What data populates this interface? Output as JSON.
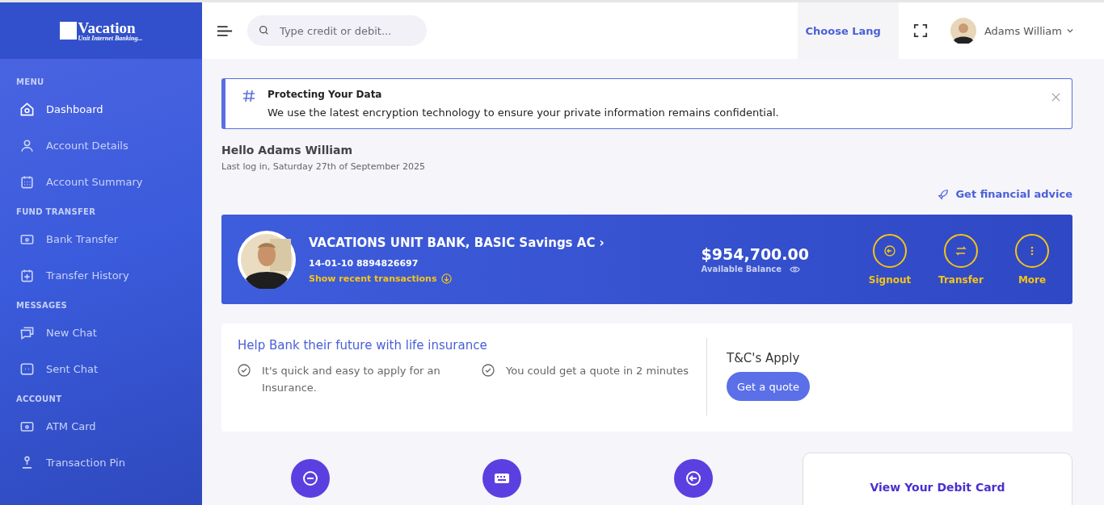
{
  "logo": {
    "title": "Vacation",
    "tagline": "Unit Internet Banking..."
  },
  "sidebar": {
    "sections": [
      {
        "heading": "MENU",
        "items": [
          {
            "label": "Dashboard",
            "selected": true
          },
          {
            "label": "Account Details",
            "selected": false
          },
          {
            "label": "Account Summary",
            "selected": false
          }
        ]
      },
      {
        "heading": "FUND TRANSFER",
        "items": [
          {
            "label": "Bank Transfer",
            "selected": false
          },
          {
            "label": "Transfer History",
            "selected": false
          }
        ]
      },
      {
        "heading": "MESSAGES",
        "items": [
          {
            "label": "New Chat",
            "selected": false
          },
          {
            "label": "Sent Chat",
            "selected": false
          }
        ]
      },
      {
        "heading": "ACCOUNT",
        "items": [
          {
            "label": "ATM Card",
            "selected": false
          },
          {
            "label": "Transaction Pin",
            "selected": false
          }
        ]
      }
    ]
  },
  "topbar": {
    "search": {
      "placeholder": "Type credit or debit..."
    },
    "language": "Choose Lang",
    "user": "Adams William"
  },
  "alert": {
    "title": "Protecting Your Data",
    "message": "We use the latest encryption technology to ensure your private information remains confidential."
  },
  "greeting": {
    "title": "Hello Adams William",
    "last_login": "Last log in, Saturday 27th of September 2025",
    "advice_link": "Get financial advice"
  },
  "account": {
    "name": "VACATIONS UNIT BANK, BASIC Savings AC ›",
    "number": "14-01-10 8894826697",
    "recent_link": "Show recent transactions",
    "balance": "$954,700.00",
    "balance_label": "Available Balance",
    "actions": [
      "Signout",
      "Transfer",
      "More"
    ]
  },
  "insurance": {
    "title": "Help Bank their future with life insurance",
    "points": [
      "It's quick and easy to apply for an Insurance.",
      "You could get a quote in 2 minutes"
    ],
    "terms": "T&C's Apply",
    "button": "Get a quote"
  },
  "debit_card": {
    "link": "View Your Debit Card"
  }
}
